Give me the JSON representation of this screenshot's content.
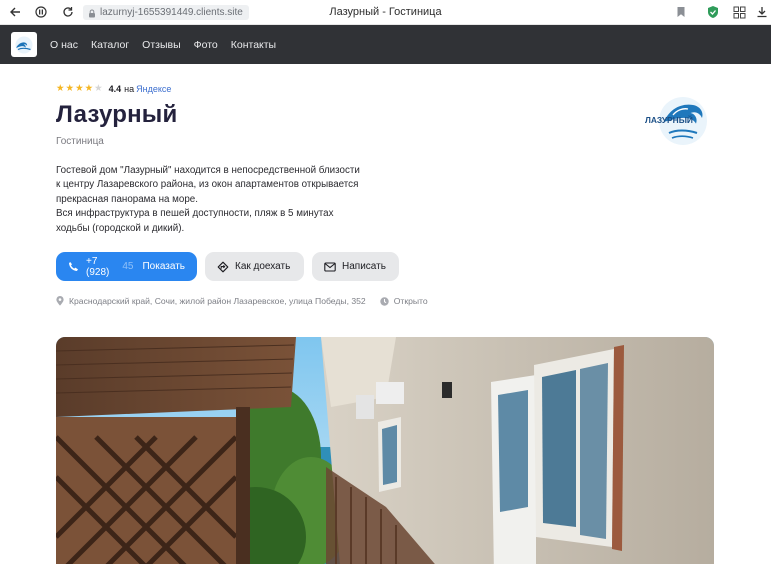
{
  "browser": {
    "url": "lazurnyj-1655391449.clients.site",
    "tab_title": "Лазурный - Гостиница"
  },
  "nav": {
    "items": [
      {
        "label": "О нас"
      },
      {
        "label": "Каталог"
      },
      {
        "label": "Отзывы"
      },
      {
        "label": "Фото"
      },
      {
        "label": "Контакты"
      }
    ]
  },
  "rating": {
    "stars_filled": 4,
    "stars_total": 5,
    "value": "4.4",
    "on_text": "на",
    "source": "Яндексе"
  },
  "hotel": {
    "name": "Лазурный",
    "category": "Гостиница",
    "logo_text": "ЛАЗУРНЫЙ",
    "description": [
      "Гостевой дом \"Лазурный\" находится в непосредственной близости к центру Лазаревского района, из окон апартаментов открывается прекрасная панорама на море.",
      "Вся инфраструктура в пешей доступности, пляж в 5 минутах ходьбы (городской и дикий)."
    ]
  },
  "actions": {
    "phone_visible": "+7 (928)",
    "phone_hidden": "45",
    "show_label": "Показать",
    "route_label": "Как доехать",
    "write_label": "Написать"
  },
  "address": {
    "text": "Краснодарский край, Сочи, жилой район Лазаревское, улица Победы, 352",
    "status": "Открыто"
  },
  "colors": {
    "navbar_bg": "#303236",
    "primary_button": "#2a86f0",
    "secondary_button": "#e7e8ea",
    "star_filled": "#f5b623",
    "star_empty": "#d6d6d6",
    "link": "#3d6fcf"
  },
  "icons": {
    "back": "arrow-left-icon",
    "forward": "page-info-icon",
    "reload": "reload-icon",
    "bookmark": "bookmark-icon",
    "shield": "shield-icon",
    "extensions": "extensions-icon",
    "download": "download-icon",
    "phone": "phone-icon",
    "route": "route-icon",
    "mail": "mail-icon",
    "location": "location-pin-icon",
    "clock": "clock-icon"
  }
}
